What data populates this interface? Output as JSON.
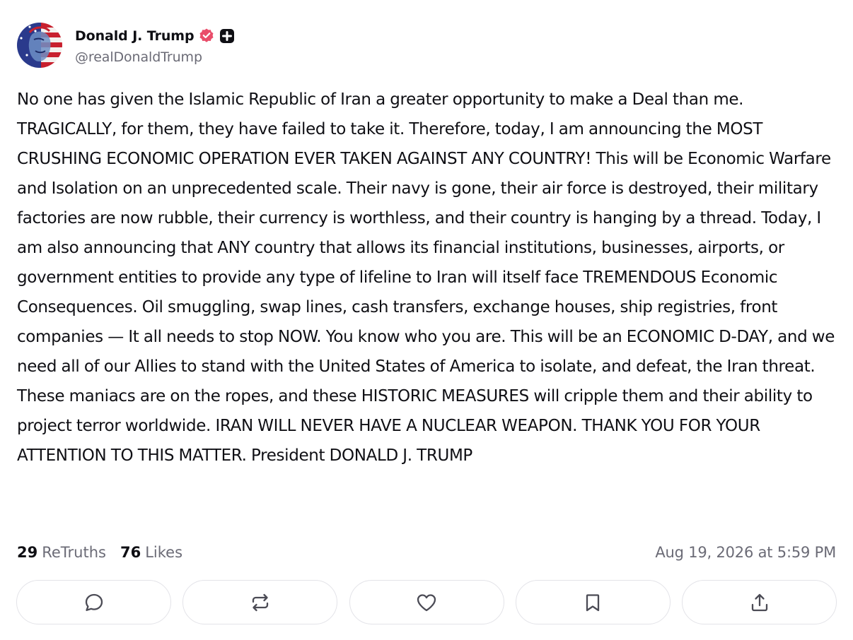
{
  "author": {
    "display_name": "Donald J. Trump",
    "handle": "@realDonaldTrump",
    "avatar_icon": "flag-portrait-avatar",
    "verified_badge_icon": "verified-badge-icon",
    "verified_badge_color": "#e94d6a",
    "plus_badge_icon": "plus-badge-icon"
  },
  "post": {
    "text": "No one has given the Islamic Republic of Iran a greater opportunity to make a Deal than me. TRAGICALLY, for them, they have failed to take it. Therefore, today, I am announcing the MOST CRUSHING ECONOMIC OPERATION EVER TAKEN AGAINST ANY COUNTRY! This will be Economic Warfare and Isolation on an unprecedented scale. Their navy is gone, their air force is destroyed, their military factories are now rubble, their currency is worthless, and their country is hanging by a thread. Today, I am also announcing that ANY country that allows its financial institutions, businesses, airports, or government entities to provide any type of lifeline to Iran will itself face TREMENDOUS Economic Consequences. Oil smuggling, swap lines, cash transfers, exchange houses, ship registries, front companies — It all needs to stop NOW. You know who you are. This will be an ECONOMIC D-DAY, and we need all of our Allies to stand with the United States of America to isolate, and defeat, the Iran threat. These maniacs are on the ropes, and these HISTORIC MEASURES will cripple them and their ability to project terror worldwide. IRAN WILL NEVER HAVE A NUCLEAR WEAPON. THANK YOU FOR YOUR ATTENTION TO THIS MATTER. President DONALD J. TRUMP"
  },
  "stats": {
    "retruths_count": "29",
    "retruths_label": "ReTruths",
    "likes_count": "76",
    "likes_label": "Likes",
    "timestamp": "Aug 19, 2026 at 5:59 PM"
  },
  "actions": [
    {
      "icon": "reply-icon"
    },
    {
      "icon": "retruth-icon"
    },
    {
      "icon": "like-icon"
    },
    {
      "icon": "bookmark-icon"
    },
    {
      "icon": "share-icon"
    }
  ],
  "colors": {
    "text_primary": "#0f0f14",
    "text_secondary": "#6b6b76",
    "border": "#e3e3e8",
    "icon": "#4b4b55"
  }
}
